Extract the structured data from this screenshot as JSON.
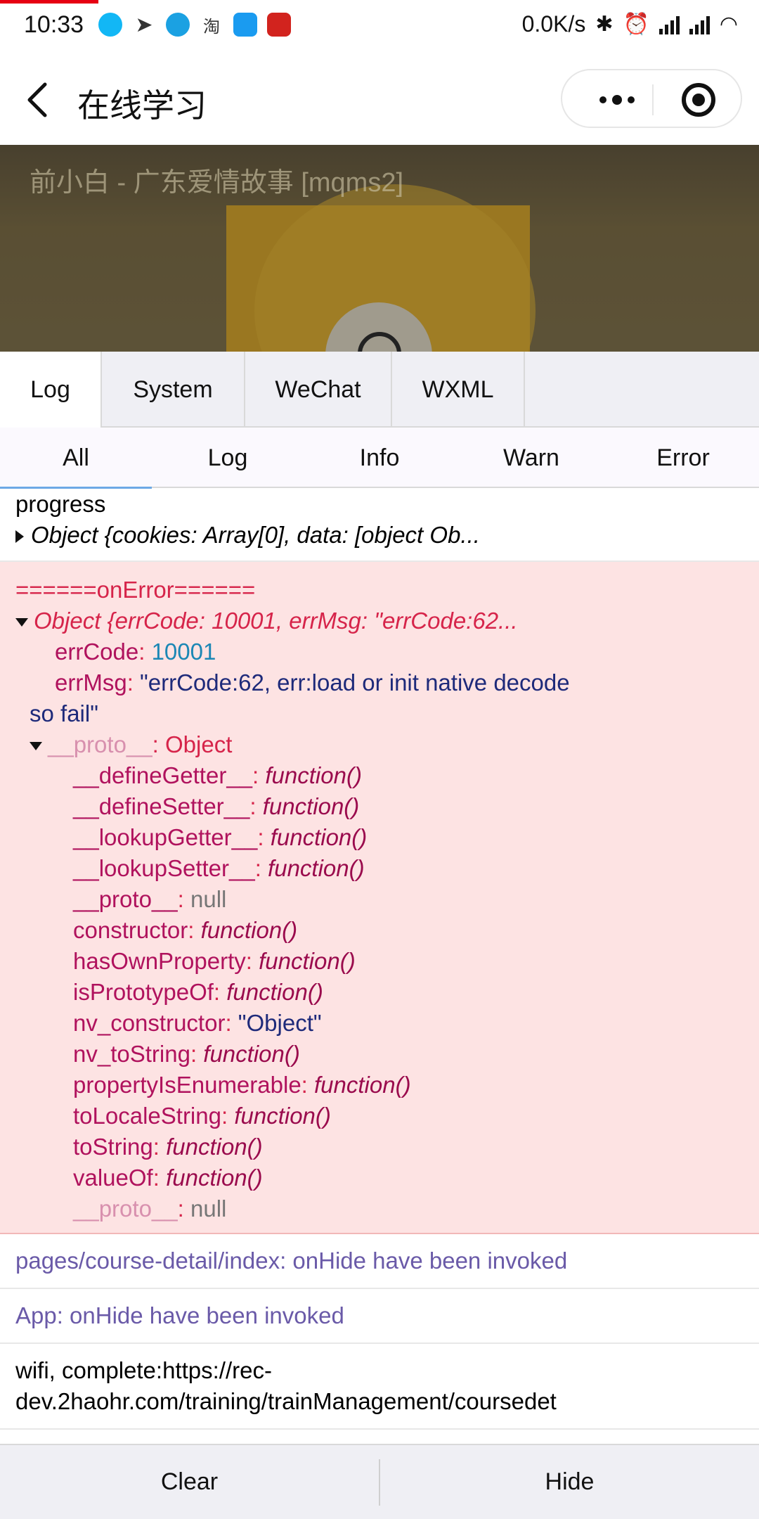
{
  "status_bar": {
    "time": "10:33",
    "taobao_label": "淘",
    "net_speed": "0.0K/s"
  },
  "navbar": {
    "title": "在线学习"
  },
  "video": {
    "marquee": "前小白 - 广东爱情故事 [mqms2]"
  },
  "tabs": [
    "Log",
    "System",
    "WeChat",
    "WXML"
  ],
  "subtabs": [
    "All",
    "Log",
    "Info",
    "Warn",
    "Error"
  ],
  "logs": {
    "progress_label": "progress",
    "progress_object": "Object {cookies: Array[0], data: [object Ob...",
    "error_title": "======onError======",
    "error_object": "Object {errCode: 10001, errMsg: \"errCode:62...",
    "errcode_key": "errCode",
    "errcode_val": "10001",
    "errmsg_key": "errMsg",
    "errmsg_val_1": "\"errCode:62, err:load or init native decode",
    "errmsg_val_2": "so fail\"",
    "proto_key": "__proto__",
    "proto_val": "Object",
    "proto_members": [
      {
        "key": "__defineGetter__",
        "val": "function()",
        "type": "fn"
      },
      {
        "key": "__defineSetter__",
        "val": "function()",
        "type": "fn"
      },
      {
        "key": "__lookupGetter__",
        "val": "function()",
        "type": "fn"
      },
      {
        "key": "__lookupSetter__",
        "val": "function()",
        "type": "fn"
      },
      {
        "key": "__proto__",
        "val": "null",
        "type": "null"
      },
      {
        "key": "constructor",
        "val": "function()",
        "type": "fn"
      },
      {
        "key": "hasOwnProperty",
        "val": "function()",
        "type": "fn"
      },
      {
        "key": "isPrototypeOf",
        "val": "function()",
        "type": "fn"
      },
      {
        "key": "nv_constructor",
        "val": "\"Object\"",
        "type": "str"
      },
      {
        "key": "nv_toString",
        "val": "function()",
        "type": "fn"
      },
      {
        "key": "propertyIsEnumerable",
        "val": "function()",
        "type": "fn"
      },
      {
        "key": "toLocaleString",
        "val": "function()",
        "type": "fn"
      },
      {
        "key": "toString",
        "val": "function()",
        "type": "fn"
      },
      {
        "key": "valueOf",
        "val": "function()",
        "type": "fn"
      },
      {
        "key": "__proto__",
        "val": "null",
        "type": "dimnull"
      }
    ],
    "info_1": "pages/course-detail/index: onHide have been invoked",
    "info_2": "App: onHide have been invoked",
    "wifi_1": "wifi, complete:https://rec-",
    "wifi_2": "dev.2haohr.com/training/trainManagement/coursedet"
  },
  "bottom": {
    "clear": "Clear",
    "hide": "Hide"
  },
  "colors": {
    "error_bg": "#fde3e3",
    "error_text": "#d6244a",
    "info_text": "#6a5aa8",
    "tab_bg": "#efeff4"
  }
}
